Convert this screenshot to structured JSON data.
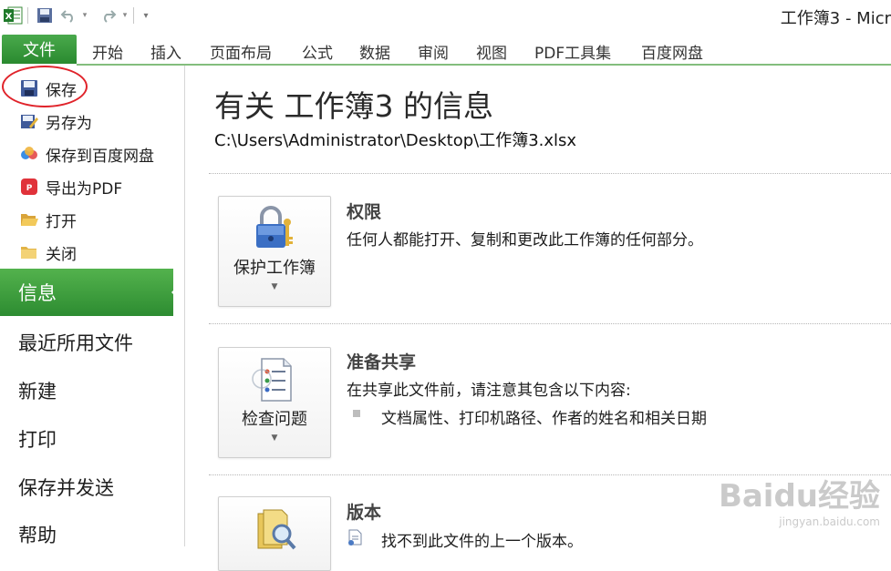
{
  "window": {
    "title": "工作簿3 - Micr"
  },
  "quick_access": {
    "app_icon": "excel-icon",
    "save": "save-icon",
    "undo": "undo-icon",
    "redo": "redo-icon",
    "customize": "customize-arrow-icon"
  },
  "ribbon": {
    "file_tab": "文件",
    "tabs": [
      "开始",
      "插入",
      "页面布局",
      "公式",
      "数据",
      "审阅",
      "视图",
      "PDF工具集",
      "百度网盘"
    ]
  },
  "backstage_nav": {
    "commands": [
      {
        "label": "保存",
        "icon": "floppy-disk-icon"
      },
      {
        "label": "另存为",
        "icon": "save-as-icon"
      },
      {
        "label": "保存到百度网盘",
        "icon": "baidu-cloud-icon"
      },
      {
        "label": "导出为PDF",
        "icon": "pdf-icon"
      },
      {
        "label": "打开",
        "icon": "open-folder-icon"
      },
      {
        "label": "关闭",
        "icon": "close-folder-icon"
      }
    ],
    "selected": "信息",
    "items": [
      "最近所用文件",
      "新建",
      "打印",
      "保存并发送",
      "帮助"
    ]
  },
  "info": {
    "title": "有关 工作簿3 的信息",
    "path": "C:\\Users\\Administrator\\Desktop\\工作簿3.xlsx",
    "sections": [
      {
        "button_label": "保护工作簿",
        "icon": "lock-key-icon",
        "heading": "权限",
        "text": "任何人都能打开、复制和更改此工作簿的任何部分。"
      },
      {
        "button_label": "检查问题",
        "icon": "checklist-icon",
        "heading": "准备共享",
        "text": "在共享此文件前，请注意其包含以下内容:",
        "bullets": [
          "文档属性、打印机路径、作者的姓名和相关日期"
        ]
      },
      {
        "button_label": "",
        "icon": "versions-search-icon",
        "heading": "版本",
        "text": "找不到此文件的上一个版本。"
      }
    ]
  },
  "watermark": {
    "line1": "Baidu经验",
    "line2": "jingyan.baidu.com"
  },
  "colors": {
    "file_tab": "#2f8f34",
    "selected_nav": "#3f9f3f",
    "highlight_circle": "#e0232a"
  }
}
